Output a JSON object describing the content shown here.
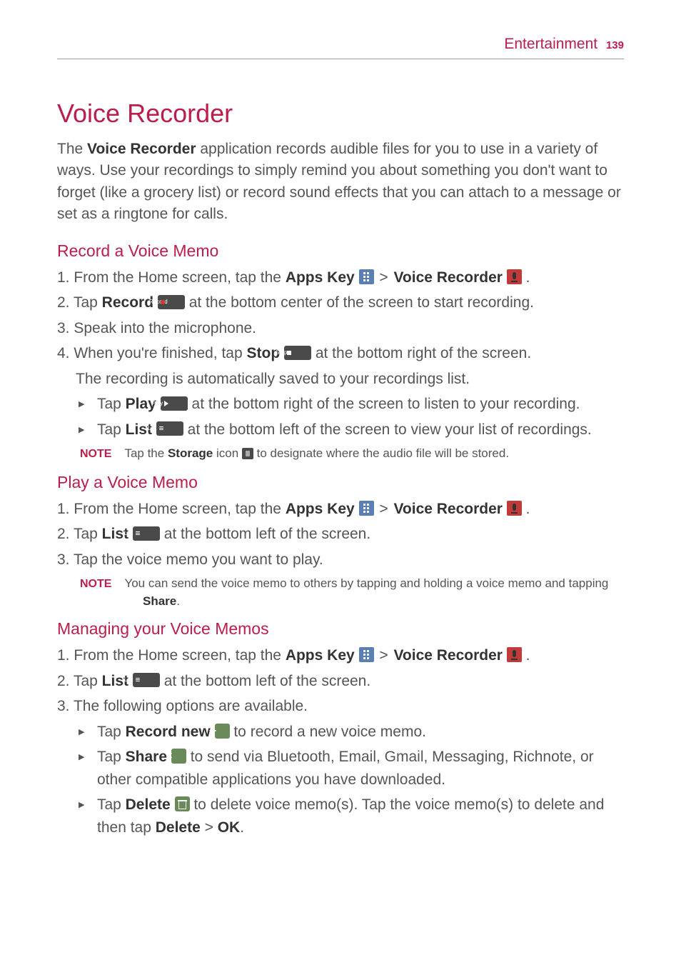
{
  "header": {
    "section": "Entertainment",
    "page": "139"
  },
  "title": "Voice Recorder",
  "intro_pre": "The ",
  "intro_bold": "Voice Recorder",
  "intro_post": " application records audible files for you to use in a variety of ways. Use your recordings to simply remind you about something you don't want to forget (like a grocery list) or record sound effects that you can attach to a message or set as a ringtone for calls.",
  "rec": {
    "heading": "Record a Voice Memo",
    "s1_a": "1.  From the Home screen, tap the ",
    "s1_apps": "Apps Key",
    "s1_gt": " > ",
    "s1_vr": "Voice Recorder",
    "s1_end": " .",
    "s2_a": "2. Tap ",
    "s2_b": "Record",
    "s2_c": " at the bottom center of the screen to start recording.",
    "s3": "3. Speak into the microphone.",
    "s4_a": "4. When you're finished, tap ",
    "s4_b": "Stop",
    "s4_c": " at the bottom right of the screen.",
    "s4_sub": "The recording is automatically saved to your recordings list.",
    "b1_a": "Tap ",
    "b1_b": "Play",
    "b1_c": " at the bottom right of the screen to listen to your recording.",
    "b2_a": "Tap ",
    "b2_b": "List",
    "b2_c": " at the bottom left of the screen to view your list of recordings.",
    "note_label": "NOTE",
    "note_a": "Tap the ",
    "note_b": "Storage",
    "note_c": " icon ",
    "note_d": " to designate where the audio file will be stored."
  },
  "play": {
    "heading": "Play a Voice Memo",
    "s1_a": "1.  From the Home screen, tap the ",
    "s1_apps": "Apps Key",
    "s1_gt": " > ",
    "s1_vr": "Voice Recorder",
    "s1_end": " .",
    "s2_a": "2. Tap ",
    "s2_b": "List",
    "s2_c": " at the bottom left of the screen.",
    "s3": "3. Tap the voice memo you want to play.",
    "note_label": "NOTE",
    "note_a": "You can send the voice memo to others by tapping and holding a voice memo and tapping ",
    "note_b": "Share",
    "note_c": "."
  },
  "manage": {
    "heading": "Managing your Voice Memos",
    "s1_a": "1.  From the Home screen, tap the ",
    "s1_apps": "Apps Key",
    "s1_gt": " > ",
    "s1_vr": "Voice Recorder",
    "s1_end": " .",
    "s2_a": "2. Tap ",
    "s2_b": "List",
    "s2_c": " at the bottom left of the screen.",
    "s3": "3. The following options are available.",
    "b1_a": "Tap ",
    "b1_b": "Record new",
    "b1_c": " to record a new voice memo.",
    "b2_a": "Tap ",
    "b2_b": "Share",
    "b2_c": " to send via Bluetooth, Email, Gmail, Messaging, Richnote, or other compatible applications you have downloaded.",
    "b3_a": "Tap ",
    "b3_b": "Delete",
    "b3_c": " to delete voice memo(s). Tap the voice memo(s) to delete and then tap ",
    "b3_d": "Delete",
    "b3_gt": " > ",
    "b3_e": "OK",
    "b3_f": "."
  },
  "icon_labels": {
    "record": "Record",
    "stop": "Stop",
    "play": "Play",
    "list": "List",
    "plus": "+",
    "share": "<"
  }
}
